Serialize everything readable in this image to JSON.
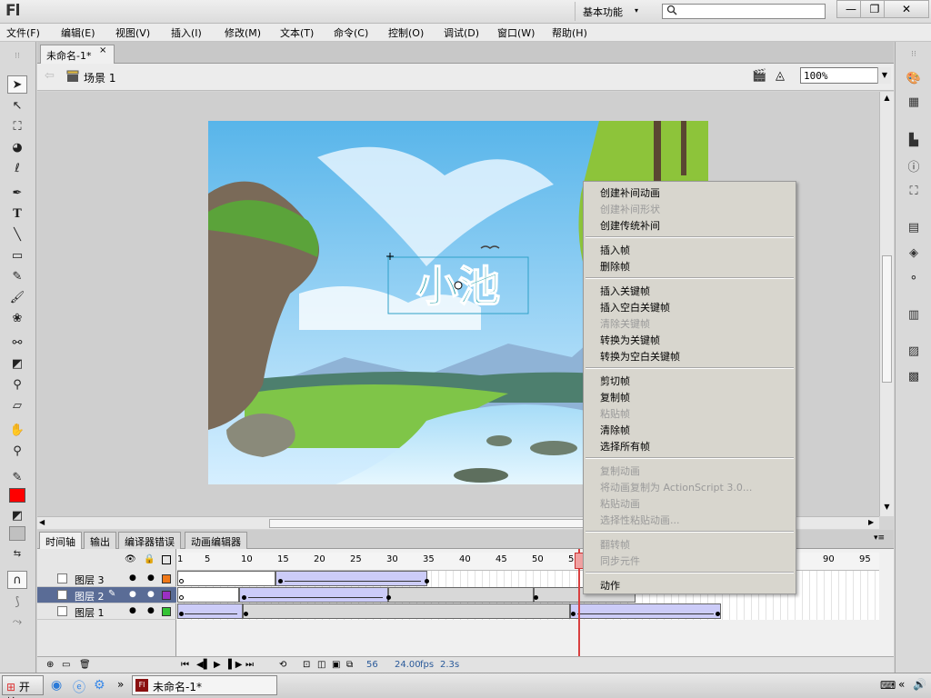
{
  "app": {
    "logo": "Fl",
    "workspace": "基本功能",
    "workspace_arrow": "▾"
  },
  "search": {
    "placeholder": ""
  },
  "window_controls": {
    "minimize": "—",
    "restore": "❐",
    "close": "✕"
  },
  "menus": [
    "文件(F)",
    "编辑(E)",
    "视图(V)",
    "插入(I)",
    "修改(M)",
    "文本(T)",
    "命令(C)",
    "控制(O)",
    "调试(D)",
    "窗口(W)",
    "帮助(H)"
  ],
  "document": {
    "tab_title": "未命名-1*",
    "tab_close": "×",
    "scene": "场景 1",
    "zoom": "100%"
  },
  "stage": {
    "title_text": "小池"
  },
  "timeline": {
    "tabs": [
      "时间轴",
      "输出",
      "编译器错误",
      "动画编辑器"
    ],
    "frame_numbers": [
      "1",
      "5",
      "10",
      "15",
      "20",
      "25",
      "30",
      "35",
      "40",
      "45",
      "50",
      "55",
      "90",
      "95"
    ],
    "layers": [
      {
        "name": "图层 3",
        "color": "#f07818",
        "selected": false
      },
      {
        "name": "图层 2",
        "color": "#9b2fc4",
        "selected": true
      },
      {
        "name": "图层 1",
        "color": "#35c435",
        "selected": false
      }
    ],
    "current_frame": "56",
    "fps": "24.00",
    "fps_unit": "fps",
    "time": "2.3",
    "time_unit": "s"
  },
  "context_menu": {
    "groups": [
      [
        {
          "label": "创建补间动画",
          "enabled": true
        },
        {
          "label": "创建补间形状",
          "enabled": false
        },
        {
          "label": "创建传统补间",
          "enabled": true
        }
      ],
      [
        {
          "label": "插入帧",
          "enabled": true
        },
        {
          "label": "删除帧",
          "enabled": true
        }
      ],
      [
        {
          "label": "插入关键帧",
          "enabled": true
        },
        {
          "label": "插入空白关键帧",
          "enabled": true
        },
        {
          "label": "清除关键帧",
          "enabled": false
        },
        {
          "label": "转换为关键帧",
          "enabled": true
        },
        {
          "label": "转换为空白关键帧",
          "enabled": true
        }
      ],
      [
        {
          "label": "剪切帧",
          "enabled": true
        },
        {
          "label": "复制帧",
          "enabled": true
        },
        {
          "label": "粘贴帧",
          "enabled": false
        },
        {
          "label": "清除帧",
          "enabled": true
        },
        {
          "label": "选择所有帧",
          "enabled": true
        }
      ],
      [
        {
          "label": "复制动画",
          "enabled": false
        },
        {
          "label": "将动画复制为 ActionScript 3.0...",
          "enabled": false
        },
        {
          "label": "粘贴动画",
          "enabled": false
        },
        {
          "label": "选择性粘贴动画...",
          "enabled": false
        }
      ],
      [
        {
          "label": "翻转帧",
          "enabled": false
        },
        {
          "label": "同步元件",
          "enabled": false
        }
      ],
      [
        {
          "label": "动作",
          "enabled": true
        }
      ]
    ]
  },
  "taskbar": {
    "start": "开始",
    "window": "未命名-1*",
    "chevrons": "»",
    "tray_chevrons": "«"
  },
  "colors": {
    "stroke": "#000000",
    "fill": "#ff0000",
    "accent": "#5a6c96",
    "playhead": "#d94040"
  }
}
